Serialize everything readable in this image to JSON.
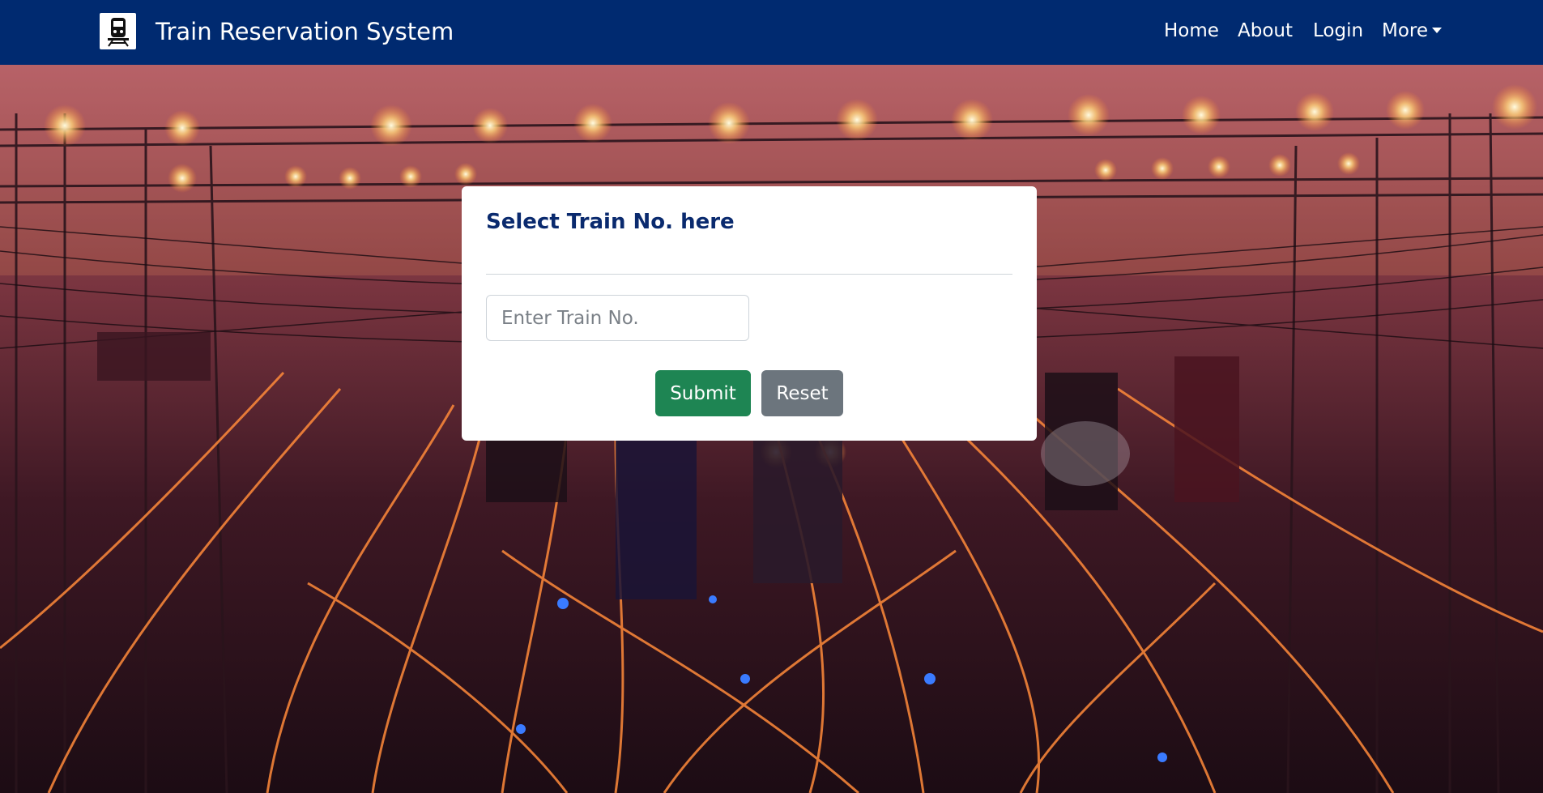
{
  "navbar": {
    "brand_title": "Train Reservation System",
    "brand_logo_icon": "train-icon",
    "links": {
      "home": "Home",
      "about": "About",
      "login": "Login",
      "more": "More"
    },
    "background_color": "#002a70"
  },
  "form_card": {
    "title": "Select Train No. here",
    "train_no_placeholder": "Enter Train No.",
    "train_no_value": "",
    "submit_label": "Submit",
    "reset_label": "Reset"
  },
  "colors": {
    "submit": "#1e8553",
    "reset": "#6c757d",
    "title": "#0a2a6e"
  }
}
